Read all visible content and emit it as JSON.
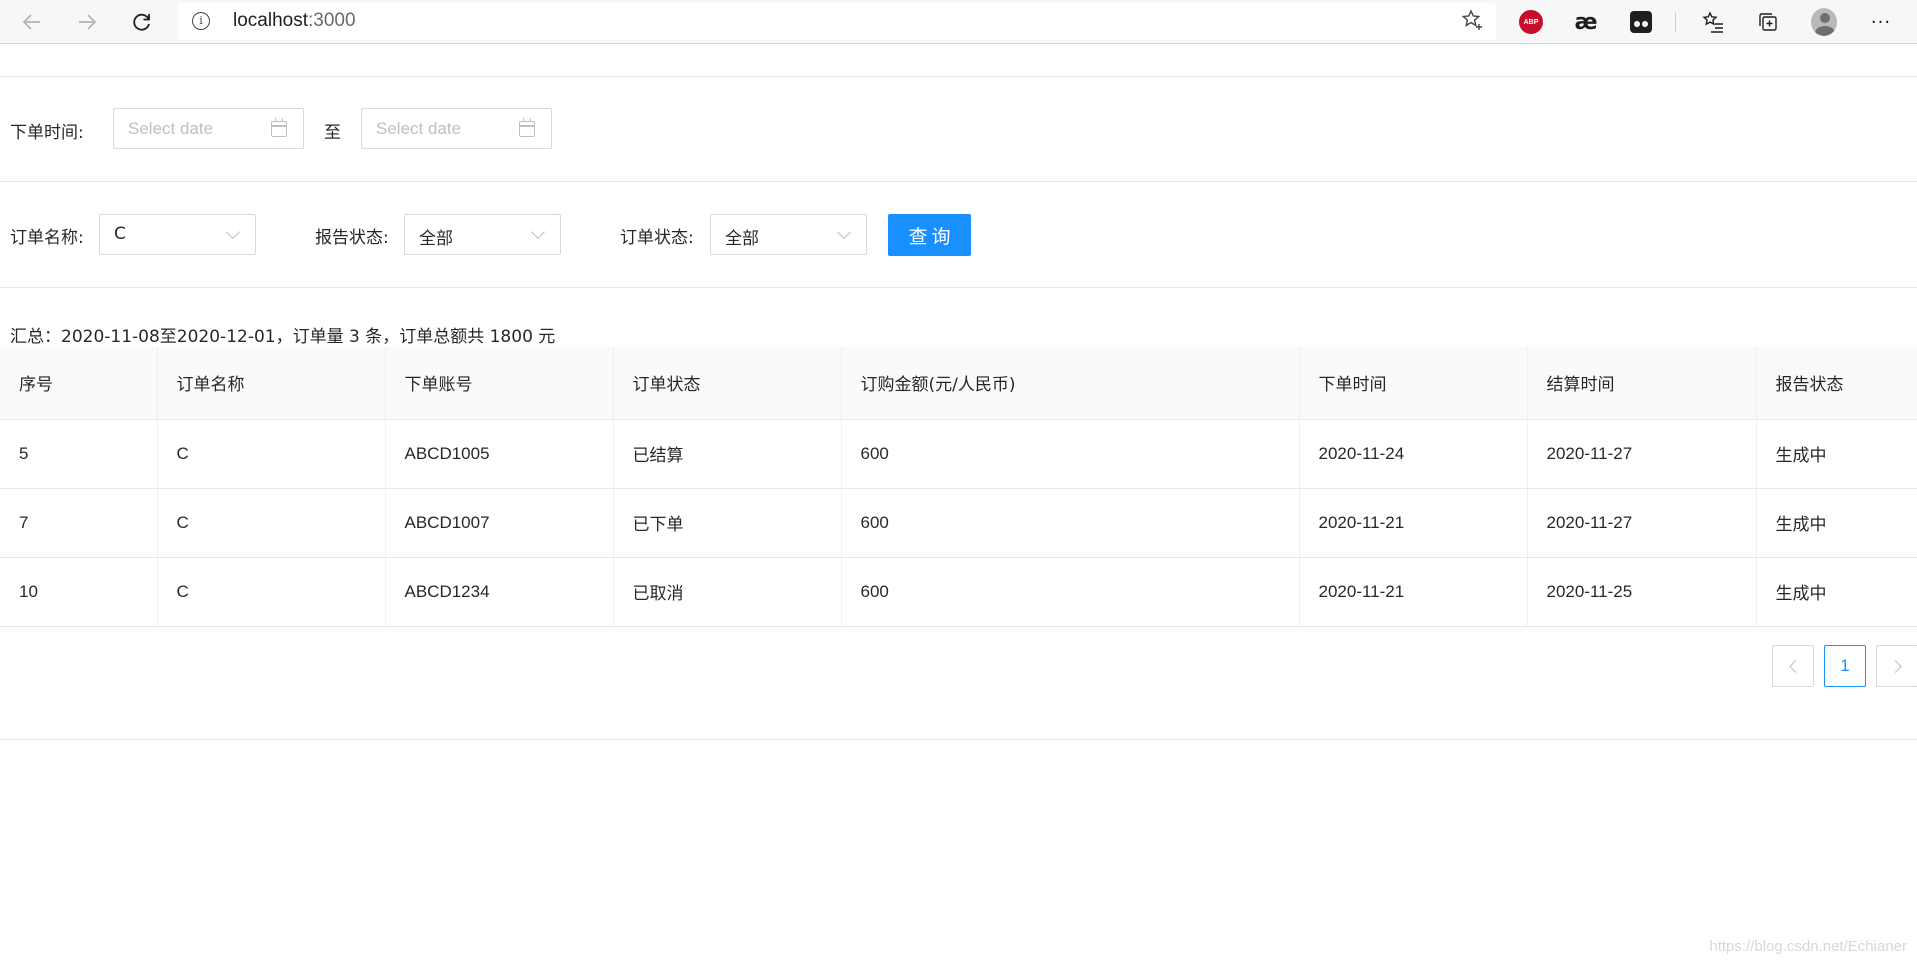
{
  "browser": {
    "url_host": "localhost",
    "url_port": ":3000",
    "icons": [
      "back-arrow-icon",
      "forward-arrow-icon",
      "refresh-icon",
      "info-icon",
      "favorite-star-icon",
      "adblock-plus-icon",
      "ae-extension-icon",
      "tampermonkey-icon",
      "favorites-icon",
      "collections-icon",
      "profile-avatar",
      "more-menu-icon"
    ],
    "abp_label": "ABP",
    "ae_label": "æ",
    "more_label": "···"
  },
  "filters": {
    "order_time_label": "下单时间:",
    "start_date_placeholder": "Select date",
    "range_separator": "至",
    "end_date_placeholder": "Select date",
    "order_name_label": "订单名称:",
    "order_name_value": "C",
    "report_status_label": "报告状态:",
    "report_status_value": "全部",
    "order_status_label": "订单状态:",
    "order_status_value": "全部",
    "query_button": "查询"
  },
  "summary": "汇总：2020-11-08至2020-12-01，订单量 3 条，订单总额共 1800 元",
  "table": {
    "columns": [
      "序号",
      "订单名称",
      "下单账号",
      "订单状态",
      "订购金额(元/人民币)",
      "下单时间",
      "结算时间",
      "报告状态"
    ],
    "rows": [
      [
        "5",
        "C",
        "ABCD1005",
        "已结算",
        "600",
        "2020-11-24",
        "2020-11-27",
        "生成中"
      ],
      [
        "7",
        "C",
        "ABCD1007",
        "已下单",
        "600",
        "2020-11-21",
        "2020-11-27",
        "生成中"
      ],
      [
        "10",
        "C",
        "ABCD1234",
        "已取消",
        "600",
        "2020-11-21",
        "2020-11-25",
        "生成中"
      ]
    ]
  },
  "pagination": {
    "current_page": "1"
  },
  "watermark": "https://blog.csdn.net/Echianer",
  "colors": {
    "primary": "#1890ff",
    "border": "#d9d9d9",
    "header_bg": "#fafafa"
  }
}
